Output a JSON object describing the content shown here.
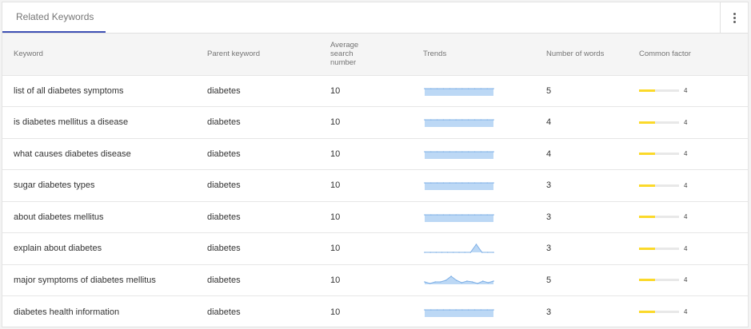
{
  "tab": {
    "label": "Related Keywords"
  },
  "menu": {
    "icon": "more-vert-icon"
  },
  "columns": {
    "keyword": "Keyword",
    "parent": "Parent keyword",
    "average": "Average search number",
    "trends": "Trends",
    "words": "Number of words",
    "common": "Common factor"
  },
  "colors": {
    "accent": "#3f51b5",
    "trend_line": "#7fb0e6",
    "trend_fill": "#bcd8f5",
    "factor_fill": "#fbd92a"
  },
  "rows": [
    {
      "keyword": "list of all diabetes symptoms",
      "parent": "diabetes",
      "average": "10",
      "words": "5",
      "common": "4",
      "common_fraction": 0.4,
      "trend": "flat-filled",
      "trend_values": [
        1,
        1,
        1,
        1,
        1,
        1,
        1,
        1,
        1,
        1,
        1,
        1
      ]
    },
    {
      "keyword": "is diabetes mellitus a disease",
      "parent": "diabetes",
      "average": "10",
      "words": "4",
      "common": "4",
      "common_fraction": 0.4,
      "trend": "flat-filled",
      "trend_values": [
        1,
        1,
        1,
        1,
        1,
        1,
        1,
        1,
        1,
        1,
        1,
        1
      ]
    },
    {
      "keyword": "what causes diabetes disease",
      "parent": "diabetes",
      "average": "10",
      "words": "4",
      "common": "4",
      "common_fraction": 0.4,
      "trend": "flat-filled",
      "trend_values": [
        1,
        1,
        1,
        1,
        1,
        1,
        1,
        1,
        1,
        1,
        1,
        1
      ]
    },
    {
      "keyword": "sugar diabetes types",
      "parent": "diabetes",
      "average": "10",
      "words": "3",
      "common": "4",
      "common_fraction": 0.4,
      "trend": "flat-filled",
      "trend_values": [
        1,
        1,
        1,
        1,
        1,
        1,
        1,
        1,
        1,
        1,
        1,
        1
      ]
    },
    {
      "keyword": "about diabetes mellitus",
      "parent": "diabetes",
      "average": "10",
      "words": "3",
      "common": "4",
      "common_fraction": 0.4,
      "trend": "flat-filled",
      "trend_values": [
        1,
        1,
        1,
        1,
        1,
        1,
        1,
        1,
        1,
        1,
        1,
        1
      ]
    },
    {
      "keyword": "explain about diabetes",
      "parent": "diabetes",
      "average": "10",
      "words": "3",
      "common": "4",
      "common_fraction": 0.4,
      "trend": "spike",
      "trend_values": [
        0,
        0,
        0,
        0,
        0,
        0,
        0,
        0,
        0,
        1,
        0,
        0,
        0
      ]
    },
    {
      "keyword": "major symptoms of diabetes mellitus",
      "parent": "diabetes",
      "average": "10",
      "words": "5",
      "common": "4",
      "common_fraction": 0.4,
      "trend": "wavy",
      "trend_values": [
        0.3,
        0.1,
        0.3,
        0.3,
        0.5,
        1,
        0.5,
        0.2,
        0.4,
        0.3,
        0.1,
        0.4,
        0.2,
        0.4
      ]
    },
    {
      "keyword": "diabetes health information",
      "parent": "diabetes",
      "average": "10",
      "words": "3",
      "common": "4",
      "common_fraction": 0.4,
      "trend": "flat-filled",
      "trend_values": [
        1,
        1,
        1,
        1,
        1,
        1,
        1,
        1,
        1,
        1,
        1,
        1
      ]
    }
  ]
}
